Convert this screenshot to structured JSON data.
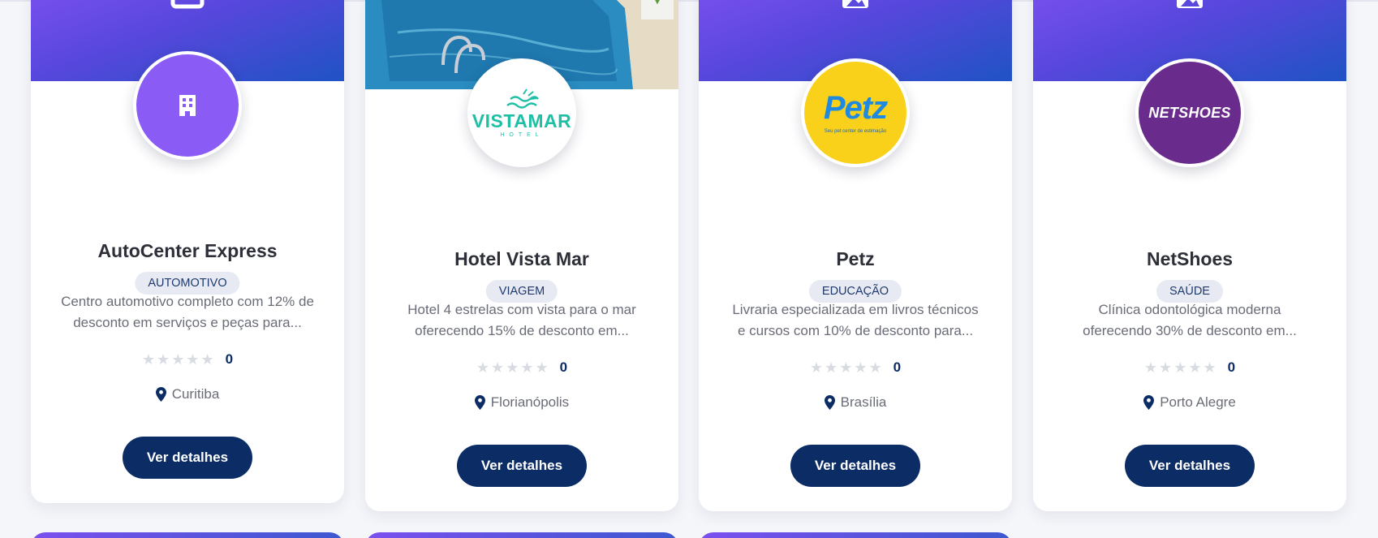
{
  "cards": [
    {
      "name": "AutoCenter Express",
      "category": "AUTOMOTIVO",
      "description": "Centro automotivo completo com 12% de desconto em serviços e peças para...",
      "rating_count": "0",
      "stars": 0,
      "city": "Curitiba",
      "button": "Ver detalhes",
      "logo_icon": "building-icon"
    },
    {
      "name": "Hotel Vista Mar",
      "category": "VIAGEM",
      "description": "Hotel 4 estrelas com vista para o mar oferecendo 15% de desconto em...",
      "rating_count": "0",
      "stars": 0,
      "city": "Florianópolis",
      "button": "Ver detalhes",
      "logo_text": "VISTAMAR",
      "logo_subtext": "HOTEL"
    },
    {
      "name": "Petz",
      "category": "EDUCAÇÃO",
      "description": "Livraria especializada em livros técnicos e cursos com 10% de desconto para...",
      "rating_count": "0",
      "stars": 0,
      "city": "Brasília",
      "button": "Ver detalhes",
      "logo_text": "Petz",
      "logo_subtext": "Seu pet center de estimação"
    },
    {
      "name": "NetShoes",
      "category": "SAÚDE",
      "description": "Clínica odontológica moderna oferecendo 30% de desconto em...",
      "rating_count": "0",
      "stars": 0,
      "city": "Porto Alegre",
      "button": "Ver detalhes",
      "logo_text": "NETSHOES"
    }
  ],
  "colors": {
    "primary": "#0c2c66",
    "banner_start": "#7b50ef",
    "banner_end": "#1f53c4",
    "badge_bg": "#e7eaf2"
  }
}
